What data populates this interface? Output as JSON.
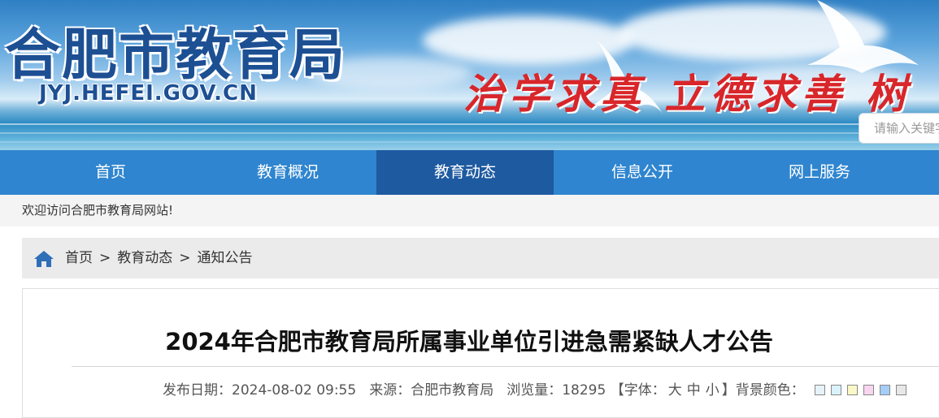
{
  "banner": {
    "title_cn": "合肥市教育局",
    "domain_url": "JYJ.HEFEI.GOV.CN",
    "slogan": "治学求真  立德求善  树",
    "search_placeholder": "请输入关键字"
  },
  "nav": {
    "items": [
      {
        "label": "首页"
      },
      {
        "label": "教育概况"
      },
      {
        "label": "教育动态",
        "active": true
      },
      {
        "label": "信息公开"
      },
      {
        "label": "网上服务"
      }
    ]
  },
  "welcome_text": "欢迎访问合肥市教育局网站!",
  "breadcrumb": {
    "items": [
      "首页",
      "教育动态",
      "通知公告"
    ],
    "separator": ">"
  },
  "article": {
    "title": "2024年合肥市教育局所属事业单位引进急需紧缺人才公告",
    "publish_label": "发布日期：",
    "publish_date": "2024-08-02 09:55",
    "source_label": "来源：",
    "source": "合肥市教育局",
    "views_label": "浏览量：",
    "views": "18295",
    "font_open": "【字体：",
    "font_large": "大",
    "font_medium": "中",
    "font_small": "小",
    "font_close": "】",
    "bg_color_label": "背景颜色：",
    "bg_swatches": [
      "#e6f3f9",
      "#d9f2fb",
      "#fbf8c7",
      "#f8d5f0",
      "#a4cdf7",
      "#e8e8e8"
    ]
  },
  "colors": {
    "nav_bg": "#2f85cf",
    "nav_active": "#1e5aa0",
    "slogan_red": "#d8262a",
    "logo_blue": "#1d4f93"
  },
  "icons": {
    "breadcrumb_home": "home-icon"
  }
}
